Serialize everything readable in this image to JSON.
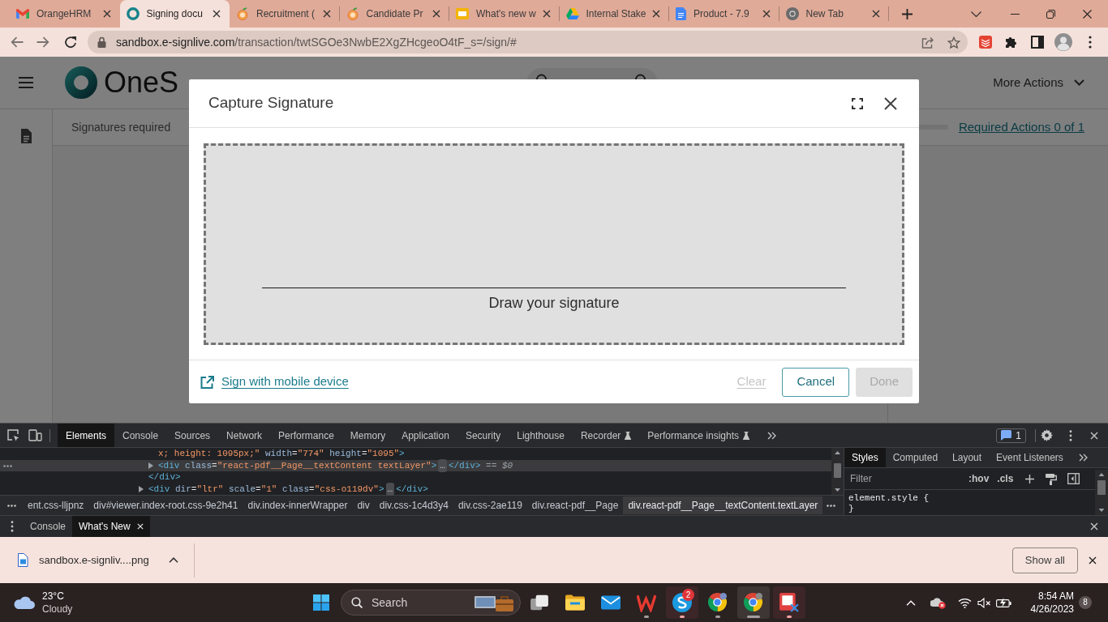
{
  "browser": {
    "tabs": [
      {
        "title": "OrangeHRM",
        "selected": false
      },
      {
        "title": "Signing docu",
        "selected": true
      },
      {
        "title": "Recruitment (",
        "selected": false
      },
      {
        "title": "Candidate Pr",
        "selected": false
      },
      {
        "title": "What's new w",
        "selected": false
      },
      {
        "title": "Internal Stake",
        "selected": false
      },
      {
        "title": "Product - 7.9",
        "selected": false
      },
      {
        "title": "New Tab",
        "selected": false
      }
    ],
    "address": {
      "host": "sandbox.e-signlive.com",
      "path": "/transaction/twtSGOe3NwbE2XgZHcgeoO4tF_s=/sign/#"
    }
  },
  "app": {
    "logo": "OneS",
    "more_actions": "More Actions",
    "status": "Signatures required",
    "progress": {
      "level": 0
    },
    "required_actions": "Required Actions 0 of 1"
  },
  "dialog": {
    "title": "Capture Signature",
    "signature_pad": {
      "placeholder": "Draw your signature"
    },
    "mobile_link": "Sign with mobile device",
    "buttons": [
      {
        "label": "Clear",
        "kind": "link",
        "disabled": true
      },
      {
        "label": "Cancel",
        "kind": "outline",
        "disabled": false
      },
      {
        "label": "Done",
        "kind": "solid",
        "disabled": true
      }
    ]
  },
  "devtools": {
    "tabs": [
      {
        "label": "Elements",
        "selected": true,
        "experimental": false
      },
      {
        "label": "Console",
        "selected": false,
        "experimental": false
      },
      {
        "label": "Sources",
        "selected": false,
        "experimental": false
      },
      {
        "label": "Network",
        "selected": false,
        "experimental": false
      },
      {
        "label": "Performance",
        "selected": false,
        "experimental": false
      },
      {
        "label": "Memory",
        "selected": false,
        "experimental": false
      },
      {
        "label": "Application",
        "selected": false,
        "experimental": false
      },
      {
        "label": "Security",
        "selected": false,
        "experimental": false
      },
      {
        "label": "Lighthouse",
        "selected": false,
        "experimental": false
      },
      {
        "label": "Recorder",
        "selected": false,
        "experimental": true
      },
      {
        "label": "Performance insights",
        "selected": false,
        "experimental": true
      }
    ],
    "issues": "1",
    "dom_tree": [
      {
        "children": [
          {
            "selected": false,
            "tokens": [
              {
                "kind": "value",
                "text": "x; height: 1095px;\""
              },
              {
                "kind": "name",
                "text": " width"
              },
              {
                "kind": "punct",
                "text": "="
              },
              {
                "kind": "value",
                "text": "\"774\""
              },
              {
                "kind": "name",
                "text": " height"
              },
              {
                "kind": "punct",
                "text": "="
              },
              {
                "kind": "value",
                "text": "\"1095\""
              },
              {
                "kind": "tag",
                "text": ">"
              }
            ]
          },
          {
            "selected": true,
            "expanded": false,
            "tokens": [
              {
                "kind": "tag",
                "text": "<div"
              },
              {
                "kind": "name",
                "text": " class"
              },
              {
                "kind": "punct",
                "text": "="
              },
              {
                "kind": "value",
                "text": "\"react-pdf__Page__textContent textLayer\""
              },
              {
                "kind": "tag",
                "text": ">"
              },
              {
                "kind": "collapsed",
                "text": "…"
              },
              {
                "kind": "tag",
                "text": "</div>"
              },
              {
                "kind": "marker",
                "text": " == $0"
              }
            ]
          }
        ],
        "closing": [
          {
            "kind": "tag",
            "text": "</div>"
          }
        ]
      },
      {
        "selected": false,
        "expanded": false,
        "tokens": [
          {
            "kind": "tag",
            "text": "<div"
          },
          {
            "kind": "name",
            "text": " dir"
          },
          {
            "kind": "punct",
            "text": "="
          },
          {
            "kind": "value",
            "text": "\"ltr\""
          },
          {
            "kind": "name",
            "text": " scale"
          },
          {
            "kind": "punct",
            "text": "="
          },
          {
            "kind": "value",
            "text": "\"1\""
          },
          {
            "kind": "name",
            "text": " class"
          },
          {
            "kind": "punct",
            "text": "="
          },
          {
            "kind": "value",
            "text": "\"css-o119dv\""
          },
          {
            "kind": "tag",
            "text": ">"
          },
          {
            "kind": "collapsed",
            "text": "…"
          },
          {
            "kind": "tag",
            "text": "</div>"
          }
        ]
      }
    ],
    "breadcrumbs": [
      {
        "label": "ent.css-lljpnz",
        "selected": false
      },
      {
        "label": "div#viewer.index-root.css-9e2h41",
        "selected": false
      },
      {
        "label": "div.index-innerWrapper",
        "selected": false
      },
      {
        "label": "div",
        "selected": false
      },
      {
        "label": "div.css-1c4d3y4",
        "selected": false
      },
      {
        "label": "div.css-2ae119",
        "selected": false
      },
      {
        "label": "div.react-pdf__Page",
        "selected": false
      },
      {
        "label": "div.react-pdf__Page__textContent.textLayer",
        "selected": true
      }
    ],
    "sidebar_tabs": [
      {
        "label": "Styles",
        "selected": true
      },
      {
        "label": "Computed",
        "selected": false
      },
      {
        "label": "Layout",
        "selected": false
      },
      {
        "label": "Event Listeners",
        "selected": false
      }
    ],
    "filter": {
      "placeholder": "Filter"
    },
    "filter_buttons": [
      ":hov",
      ".cls"
    ],
    "styles": [
      "element.style {",
      "}"
    ],
    "drawer_tabs": [
      {
        "label": "Console",
        "selected": false,
        "closable": false
      },
      {
        "label": "What's New",
        "selected": true,
        "closable": true
      }
    ]
  },
  "downloads": {
    "file": "sandbox.e-signliv....png",
    "show_all": "Show all"
  },
  "taskbar": {
    "weather": {
      "temperature": "23°C",
      "condition": "Cloudy"
    },
    "search": {
      "placeholder": "Search"
    },
    "apps": [
      {
        "selected": false,
        "running": false,
        "attention": false
      },
      {
        "selected": false,
        "running": false,
        "attention": false
      },
      {
        "selected": false,
        "running": false,
        "attention": false
      },
      {
        "selected": false,
        "running": true,
        "attention": false
      },
      {
        "selected": false,
        "running": true,
        "attention": true,
        "badge": "2"
      },
      {
        "selected": false,
        "running": true,
        "attention": false
      },
      {
        "selected": true,
        "running": true,
        "attention": false
      },
      {
        "selected": false,
        "running": true,
        "attention": true
      }
    ],
    "time": "8:54 AM",
    "date": "4/26/2023",
    "notifications": "8"
  }
}
